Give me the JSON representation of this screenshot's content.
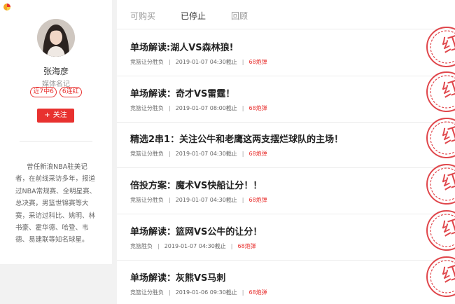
{
  "author": {
    "name": "张海彦",
    "role": "媒体名记",
    "badges": [
      "近7中6",
      "6连红"
    ],
    "follow_label": "关注",
    "follow_icon": "plus-icon",
    "bio": "曾任新浪NBA驻美记者，在前线采访多年，报道过NBA常规赛、全明星赛、总决赛，男篮世锦赛等大赛，采访过科比、姚明、林书豪、霍华德、哈登、韦德、易建联等知名球星。"
  },
  "tabs": [
    {
      "label": "可购买",
      "active": false
    },
    {
      "label": "已停止",
      "active": true
    },
    {
      "label": "回顾",
      "active": false
    }
  ],
  "stamp_text": "红",
  "colors": {
    "accent": "#e8312f",
    "stamp": "#e0474c"
  },
  "items": [
    {
      "title": "单场解读:湖人VS森林狼!",
      "category": "竞篮让分胜负",
      "time": "2019-01-07 04:30截止",
      "price": "68炮弹"
    },
    {
      "title": "单场解读：奇才VS雷霆！",
      "category": "竞篮让分胜负",
      "time": "2019-01-07 08:00截止",
      "price": "68炮弹"
    },
    {
      "title": "精选2串1：关注公牛和老鹰这两支摆烂球队的主场！",
      "category": "竞篮让分胜负",
      "time": "2019-01-07 04:30截止",
      "price": "68炮弹"
    },
    {
      "title": "倍投方案：魔术VS快船让分！！",
      "category": "竞篮让分胜负",
      "time": "2019-01-07 04:30截止",
      "price": "68炮弹"
    },
    {
      "title": "单场解读：篮网VS公牛的让分！",
      "category": "竞篮胜负",
      "time": "2019-01-07 04:30截止",
      "price": "68炮弹"
    },
    {
      "title": "单场解读：灰熊VS马刺",
      "category": "竞篮让分胜负",
      "time": "2019-01-06 09:30截止",
      "price": "68炮弹"
    }
  ]
}
